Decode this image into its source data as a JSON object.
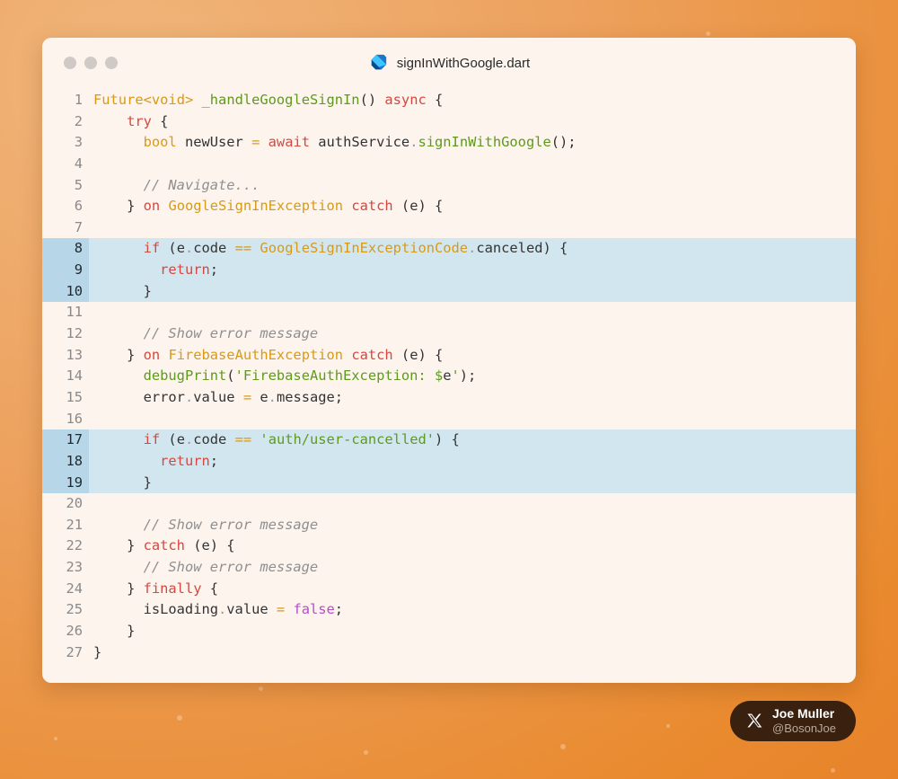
{
  "window": {
    "title": "signInWithGoogle.dart",
    "file_icon": "dart-logo-icon"
  },
  "code": {
    "highlighted_lines": [
      8,
      9,
      10,
      17,
      18,
      19
    ],
    "lines": [
      {
        "n": "1",
        "tokens": [
          [
            "ty",
            "Future"
          ],
          [
            "op",
            "<"
          ],
          [
            "ty",
            "void"
          ],
          [
            "op",
            "> "
          ],
          [
            "fn",
            "_handleGoogleSignIn"
          ],
          [
            "pl",
            "() "
          ],
          [
            "k",
            "async"
          ],
          [
            "pl",
            " {"
          ]
        ]
      },
      {
        "n": "2",
        "tokens": [
          [
            "pl",
            "    "
          ],
          [
            "k",
            "try"
          ],
          [
            "pl",
            " {"
          ]
        ]
      },
      {
        "n": "3",
        "tokens": [
          [
            "pl",
            "      "
          ],
          [
            "ty",
            "bool"
          ],
          [
            "pl",
            " newUser "
          ],
          [
            "op",
            "="
          ],
          [
            "pl",
            " "
          ],
          [
            "k",
            "await"
          ],
          [
            "pl",
            " authService"
          ],
          [
            "pu",
            "."
          ],
          [
            "fn",
            "signInWithGoogle"
          ],
          [
            "pl",
            "();"
          ]
        ]
      },
      {
        "n": "4",
        "tokens": []
      },
      {
        "n": "5",
        "tokens": [
          [
            "pl",
            "      "
          ],
          [
            "cm",
            "// Navigate..."
          ]
        ]
      },
      {
        "n": "6",
        "tokens": [
          [
            "pl",
            "    } "
          ],
          [
            "k",
            "on"
          ],
          [
            "pl",
            " "
          ],
          [
            "ty",
            "GoogleSignInException"
          ],
          [
            "pl",
            " "
          ],
          [
            "k",
            "catch"
          ],
          [
            "pl",
            " (e) {"
          ]
        ]
      },
      {
        "n": "7",
        "tokens": []
      },
      {
        "n": "8",
        "tokens": [
          [
            "pl",
            "      "
          ],
          [
            "k",
            "if"
          ],
          [
            "pl",
            " (e"
          ],
          [
            "pu",
            "."
          ],
          [
            "pl",
            "code "
          ],
          [
            "op",
            "=="
          ],
          [
            "pl",
            " "
          ],
          [
            "ty",
            "GoogleSignInExceptionCode"
          ],
          [
            "pu",
            "."
          ],
          [
            "pl",
            "canceled) {"
          ]
        ]
      },
      {
        "n": "9",
        "tokens": [
          [
            "pl",
            "        "
          ],
          [
            "k",
            "return"
          ],
          [
            "pl",
            ";"
          ]
        ]
      },
      {
        "n": "10",
        "tokens": [
          [
            "pl",
            "      }"
          ]
        ]
      },
      {
        "n": "11",
        "tokens": []
      },
      {
        "n": "12",
        "tokens": [
          [
            "pl",
            "      "
          ],
          [
            "cm",
            "// Show error message"
          ]
        ]
      },
      {
        "n": "13",
        "tokens": [
          [
            "pl",
            "    } "
          ],
          [
            "k",
            "on"
          ],
          [
            "pl",
            " "
          ],
          [
            "ty",
            "FirebaseAuthException"
          ],
          [
            "pl",
            " "
          ],
          [
            "k",
            "catch"
          ],
          [
            "pl",
            " (e) {"
          ]
        ]
      },
      {
        "n": "14",
        "tokens": [
          [
            "pl",
            "      "
          ],
          [
            "fn",
            "debugPrint"
          ],
          [
            "pl",
            "("
          ],
          [
            "st",
            "'FirebaseAuthException: $"
          ],
          [
            "pl",
            "e"
          ],
          [
            "st",
            "'"
          ],
          [
            "pl",
            ");"
          ]
        ]
      },
      {
        "n": "15",
        "tokens": [
          [
            "pl",
            "      error"
          ],
          [
            "pu",
            "."
          ],
          [
            "pl",
            "value "
          ],
          [
            "op",
            "="
          ],
          [
            "pl",
            " e"
          ],
          [
            "pu",
            "."
          ],
          [
            "pl",
            "message;"
          ]
        ]
      },
      {
        "n": "16",
        "tokens": []
      },
      {
        "n": "17",
        "tokens": [
          [
            "pl",
            "      "
          ],
          [
            "k",
            "if"
          ],
          [
            "pl",
            " (e"
          ],
          [
            "pu",
            "."
          ],
          [
            "pl",
            "code "
          ],
          [
            "op",
            "=="
          ],
          [
            "pl",
            " "
          ],
          [
            "st",
            "'auth/user-cancelled'"
          ],
          [
            "pl",
            ") {"
          ]
        ]
      },
      {
        "n": "18",
        "tokens": [
          [
            "pl",
            "        "
          ],
          [
            "k",
            "return"
          ],
          [
            "pl",
            ";"
          ]
        ]
      },
      {
        "n": "19",
        "tokens": [
          [
            "pl",
            "      }"
          ]
        ]
      },
      {
        "n": "20",
        "tokens": []
      },
      {
        "n": "21",
        "tokens": [
          [
            "pl",
            "      "
          ],
          [
            "cm",
            "// Show error message"
          ]
        ]
      },
      {
        "n": "22",
        "tokens": [
          [
            "pl",
            "    } "
          ],
          [
            "k",
            "catch"
          ],
          [
            "pl",
            " (e) {"
          ]
        ]
      },
      {
        "n": "23",
        "tokens": [
          [
            "pl",
            "      "
          ],
          [
            "cm",
            "// Show error message"
          ]
        ]
      },
      {
        "n": "24",
        "tokens": [
          [
            "pl",
            "    } "
          ],
          [
            "k",
            "finally"
          ],
          [
            "pl",
            " {"
          ]
        ]
      },
      {
        "n": "25",
        "tokens": [
          [
            "pl",
            "      isLoading"
          ],
          [
            "pu",
            "."
          ],
          [
            "pl",
            "value "
          ],
          [
            "op",
            "="
          ],
          [
            "pl",
            " "
          ],
          [
            "bo",
            "false"
          ],
          [
            "pl",
            ";"
          ]
        ]
      },
      {
        "n": "26",
        "tokens": [
          [
            "pl",
            "    }"
          ]
        ]
      },
      {
        "n": "27",
        "tokens": [
          [
            "pl",
            "}"
          ]
        ]
      }
    ]
  },
  "author": {
    "name": "Joe Muller",
    "handle": "@BosonJoe",
    "icon": "x-logo-icon"
  },
  "colors": {
    "background_accent": "#e98a2f",
    "highlight": "#d2e6f0",
    "keyword": "#d5473f",
    "type": "#d89a16",
    "function": "#5e9a1d",
    "comment": "#8f8f8f"
  }
}
